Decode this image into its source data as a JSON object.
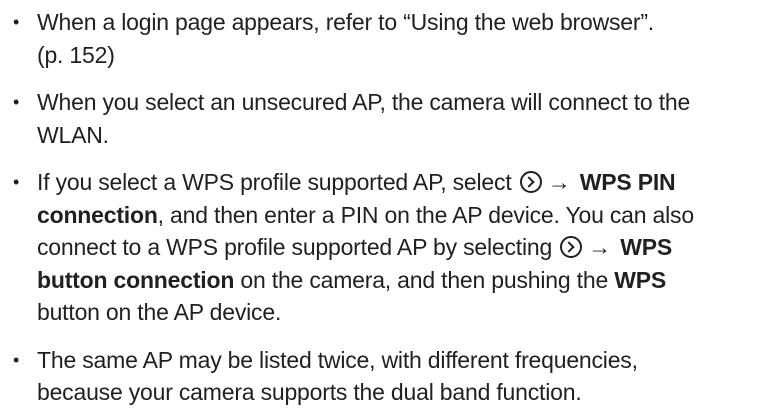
{
  "notes": [
    {
      "line1": "When a login page appears, refer to “Using the web browser”.",
      "line2": "(p. 152)"
    },
    {
      "line1": "When you select an unsecured AP, the camera will connect to the",
      "line2": "WLAN."
    },
    {
      "l1_pre": "If you select a WPS profile supported AP, select",
      "arrow": "→",
      "l1_bold": "WPS PIN",
      "l2_bold": "connection",
      "l2_post": ", and then enter a PIN on the AP device. You can also",
      "l3_pre": "connect to a WPS profile supported AP by selecting",
      "l3_bold": "WPS",
      "l4_bold": "button connection",
      "l4_mid": " on the camera, and then pushing the ",
      "l4_bold2": "WPS",
      "l5": "button on the AP device.",
      "icon": "circle-chevron-right-icon"
    },
    {
      "line1": "The same AP may be listed twice, with different frequencies,",
      "line2": "because your camera supports the dual band function."
    }
  ],
  "bullet": "•"
}
